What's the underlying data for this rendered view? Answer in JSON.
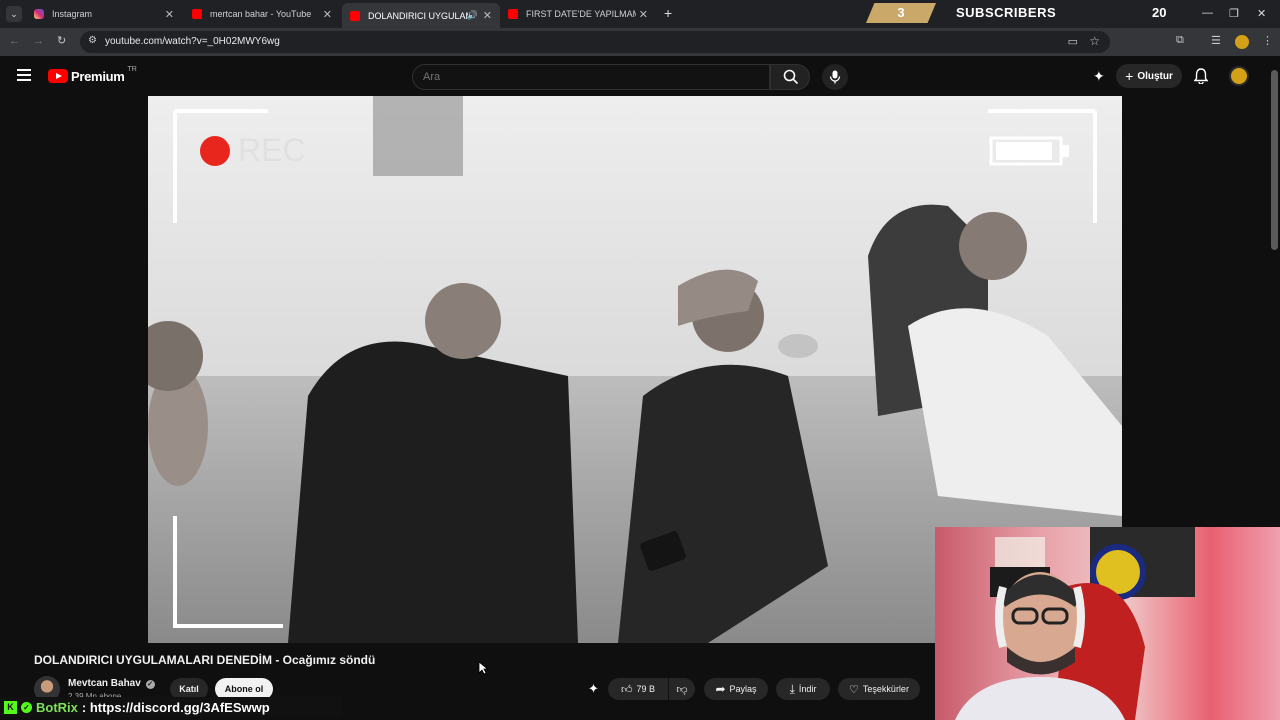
{
  "browser": {
    "tabs": [
      {
        "title": "Instagram",
        "color": "#e1306c"
      },
      {
        "title": "mertcan bahar - YouTube",
        "color": "#ff0000"
      },
      {
        "title": "DOLANDIRICI UYGULAMAL",
        "color": "#ff0000",
        "active": true
      },
      {
        "title": "FIRST DATE'DE YAPILMAMASI G",
        "color": "#ff0000"
      }
    ],
    "url": "youtube.com/watch?v=_0H02MWY6wg"
  },
  "overlay": {
    "count_left": "3",
    "label": "SUBSCRIBERS",
    "count_right": "20"
  },
  "youtube": {
    "logo_text": "Premium",
    "logo_region": "TR",
    "search_placeholder": "Ara",
    "create_label": "Oluştur"
  },
  "video": {
    "rec_text": "REC"
  },
  "info": {
    "title": "DOLANDIRICI UYGULAMALARI DENEDİM - Ocağımız söndü",
    "channel": "Mevtcan Bahav",
    "subscribers": "2,39 Mn abone",
    "join_label": "Katıl",
    "subscribe_label": "Abone ol",
    "likes": "79 B",
    "share_label": "Paylaş",
    "download_label": "İndir",
    "thanks_label": "Teşekkürler"
  },
  "chatbot": {
    "name": "BotRix",
    "message": ": https://discord.gg/3AfESwwp"
  },
  "colors": {
    "youtube_red": "#ff0000",
    "overlay_gold": "#c9a86a",
    "botrix_green": "#7ee056"
  }
}
